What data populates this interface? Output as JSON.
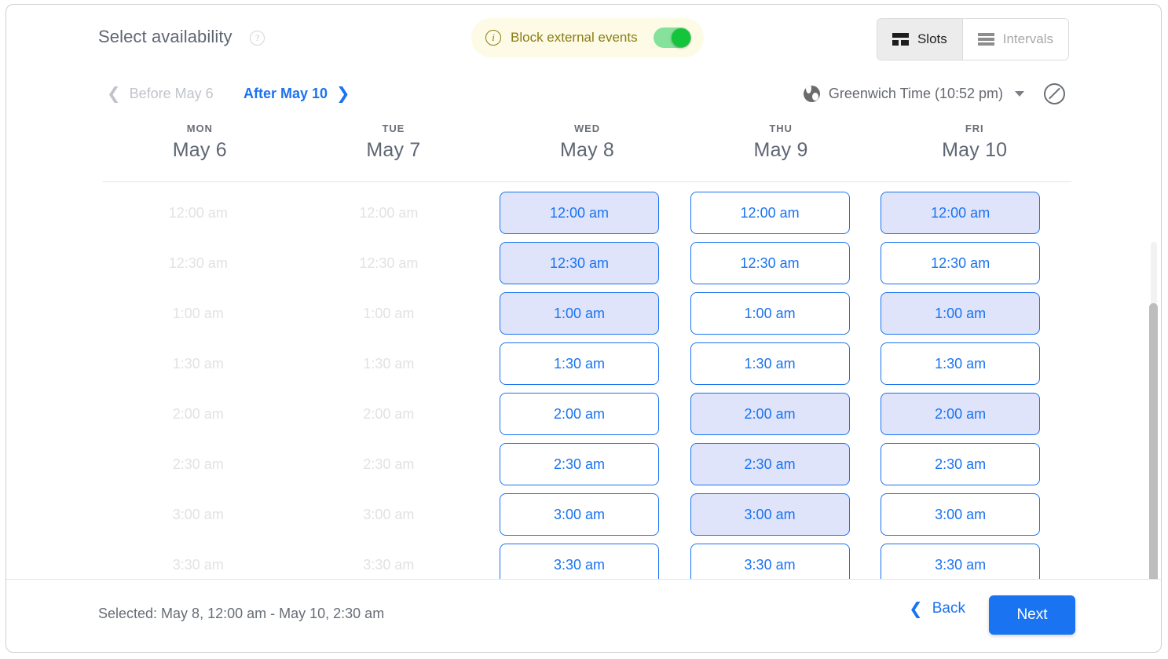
{
  "header": {
    "title": "Select availability",
    "help_icon": "help-circle-icon",
    "banner": {
      "info_icon": "info-circle-icon",
      "label": "Block external events",
      "toggle_on": true,
      "bg_color": "#fdfbe6",
      "text_color": "#8a7c15",
      "toggle_color": "#14c43b"
    },
    "view_toggle": {
      "options": [
        {
          "label": "Slots",
          "icon": "slots-grid-icon",
          "active": true
        },
        {
          "label": "Intervals",
          "icon": "intervals-lines-icon",
          "active": false
        }
      ]
    }
  },
  "nav": {
    "prev_label": "Before May 6",
    "prev_enabled": false,
    "next_label": "After May 10",
    "next_enabled": true,
    "prev_icon": "chevron-left-icon",
    "next_icon": "chevron-right-icon"
  },
  "timezone": {
    "globe_icon": "globe-icon",
    "label": "Greenwich Time (10:52 pm)",
    "caret_icon": "chevron-down-icon",
    "no_entry_icon": "no-entry-icon"
  },
  "days": [
    {
      "dow": "MON",
      "date": "May 6",
      "enabled": false
    },
    {
      "dow": "TUE",
      "date": "May 7",
      "enabled": false
    },
    {
      "dow": "WED",
      "date": "May 8",
      "enabled": true
    },
    {
      "dow": "THU",
      "date": "May 9",
      "enabled": true
    },
    {
      "dow": "FRI",
      "date": "May 10",
      "enabled": true
    }
  ],
  "times": [
    "12:00 am",
    "12:30 am",
    "1:00 am",
    "1:30 am",
    "2:00 am",
    "2:30 am",
    "3:00 am",
    "3:30 am"
  ],
  "slots": [
    {
      "day": "May 6",
      "enabled": false,
      "selected": [
        false,
        false,
        false,
        false,
        false,
        false,
        false,
        false
      ]
    },
    {
      "day": "May 7",
      "enabled": false,
      "selected": [
        false,
        false,
        false,
        false,
        false,
        false,
        false,
        false
      ]
    },
    {
      "day": "May 8",
      "enabled": true,
      "selected": [
        true,
        true,
        true,
        false,
        false,
        false,
        false,
        false
      ]
    },
    {
      "day": "May 9",
      "enabled": true,
      "selected": [
        false,
        false,
        false,
        false,
        true,
        true,
        true,
        false
      ]
    },
    {
      "day": "May 10",
      "enabled": true,
      "selected": [
        true,
        false,
        true,
        false,
        true,
        false,
        false,
        false
      ]
    }
  ],
  "colors": {
    "accent": "#1a73f0",
    "slot_selected_bg": "#dfe4fb",
    "slot_border": "#1a73f0",
    "disabled_text": "#e2e2e2"
  },
  "footer": {
    "selected_text": "Selected: May 8, 12:00 am - May 10, 2:30 am",
    "back_label": "Back",
    "back_icon": "chevron-left-icon",
    "next_label": "Next"
  }
}
